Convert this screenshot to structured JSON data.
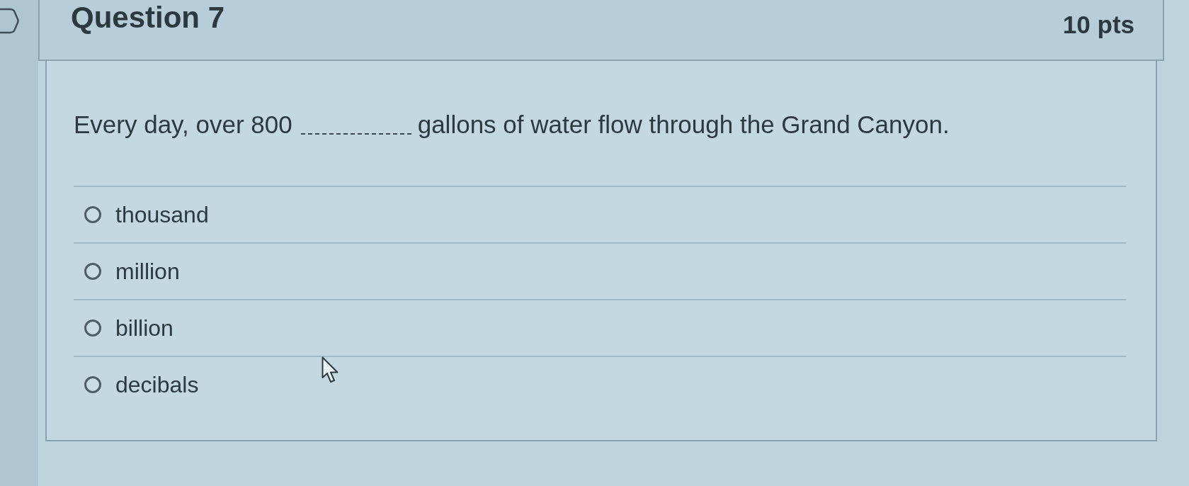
{
  "question": {
    "title": "Question 7",
    "points": "10 pts",
    "flagged": false
  },
  "prompt": {
    "text_before": "Every day, over 800",
    "text_after": "gallons of water flow through the Grand Canyon."
  },
  "options": [
    {
      "label": "thousand",
      "selected": false
    },
    {
      "label": "million",
      "selected": false
    },
    {
      "label": "billion",
      "selected": false
    },
    {
      "label": "decibals",
      "selected": false
    }
  ]
}
